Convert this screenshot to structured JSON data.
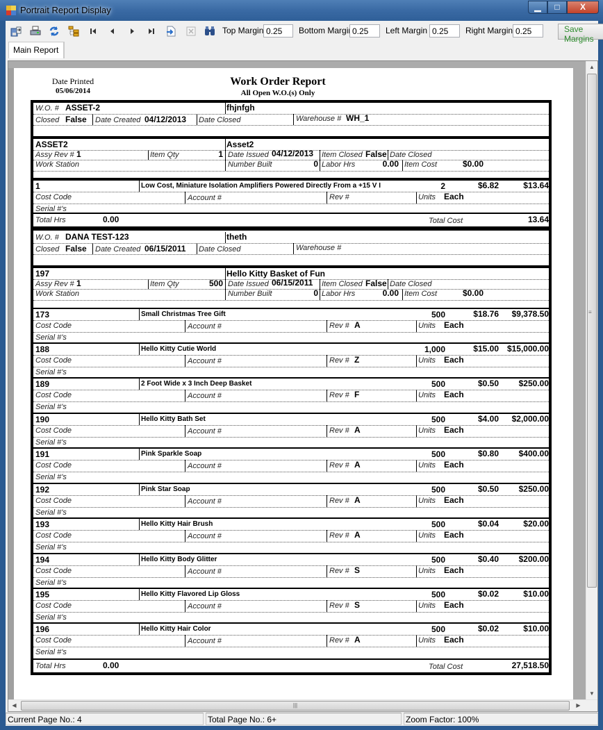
{
  "window": {
    "title": "Portrait Report Display",
    "controls": {
      "minimize": "—",
      "maximize": "□",
      "close": "X"
    }
  },
  "toolbar": {
    "icons": [
      "export-icon",
      "print-icon",
      "refresh-icon",
      "group-tree-icon",
      "first-page-icon",
      "previous-page-icon",
      "next-page-icon",
      "last-page-icon",
      "go-to-page-icon",
      "stop-icon",
      "search-icon"
    ],
    "top_margin_label": "Top Margin",
    "top_margin_value": "0.25",
    "bottom_margin_label": "Bottom Margin",
    "bottom_margin_value": "0.25",
    "left_margin_label": "Left Margin",
    "left_margin_value": "0.25",
    "right_margin_label": "Right Margin",
    "right_margin_value": "0.25",
    "save_label": "Save Margins"
  },
  "tabs": [
    {
      "label": "Main Report",
      "active": true
    }
  ],
  "report": {
    "date_printed_label": "Date Printed",
    "date_printed": "05/06/2014",
    "title": "Work Order Report",
    "subtitle": "All Open W.O.(s) Only",
    "labels": {
      "wo": "W.O. #",
      "closed": "Closed",
      "date_created": "Date Created",
      "date_closed": "Date Closed",
      "warehouse": "Warehouse #",
      "assy_rev": "Assy Rev #",
      "item_qty": "Item Qty",
      "date_issued": "Date Issued",
      "item_closed": "Item Closed",
      "work_station": "Work Station",
      "number_built": "Number Built",
      "labor_hrs": "Labor Hrs",
      "item_cost": "Item Cost",
      "cost_code": "Cost Code",
      "account": "Account #",
      "rev": "Rev #",
      "units": "Units",
      "serials": "Serial #'s",
      "total_hrs": "Total Hrs",
      "total_cost": "Total Cost"
    },
    "work_orders": [
      {
        "wo_number": "ASSET-2",
        "description": "fhjnfgh",
        "closed": "False",
        "date_created": "04/12/2013",
        "date_closed": "",
        "warehouse": "WH_1",
        "assembly": {
          "part": "ASSET2",
          "name": "Asset2",
          "assy_rev": "1",
          "item_qty": "1",
          "date_issued": "04/12/2013",
          "item_closed": "False",
          "date_closed": "",
          "work_station": "",
          "number_built": "0",
          "labor_hrs": "0.00",
          "item_cost": "$0.00"
        },
        "items": [
          {
            "part": "1",
            "description": "Low Cost, Miniature Isolation Amplifiers Powered Directly From a +15 V I",
            "qty": "2",
            "unit_cost": "$6.82",
            "ext_cost": "$13.64",
            "rev": "",
            "units": "Each"
          }
        ],
        "total_hrs": "0.00",
        "total_cost": "13.64"
      },
      {
        "wo_number": "DANA TEST-123",
        "description": "theth",
        "closed": "False",
        "date_created": "06/15/2011",
        "date_closed": "",
        "warehouse": "",
        "assembly": {
          "part": "197",
          "name": "Hello Kitty Basket of Fun",
          "assy_rev": "1",
          "item_qty": "500",
          "date_issued": "06/15/2011",
          "item_closed": "False",
          "date_closed": "",
          "work_station": "",
          "number_built": "0",
          "labor_hrs": "0.00",
          "item_cost": "$0.00"
        },
        "items": [
          {
            "part": "173",
            "description": "Small Christmas Tree Gift",
            "qty": "500",
            "unit_cost": "$18.76",
            "ext_cost": "$9,378.50",
            "rev": "A",
            "units": "Each"
          },
          {
            "part": "188",
            "description": "Hello Kitty Cutie World",
            "qty": "1,000",
            "unit_cost": "$15.00",
            "ext_cost": "$15,000.00",
            "rev": "Z",
            "units": "Each"
          },
          {
            "part": "189",
            "description": "2 Foot Wide x 3 Inch Deep Basket",
            "qty": "500",
            "unit_cost": "$0.50",
            "ext_cost": "$250.00",
            "rev": "F",
            "units": "Each"
          },
          {
            "part": "190",
            "description": "Hello Kitty Bath Set",
            "qty": "500",
            "unit_cost": "$4.00",
            "ext_cost": "$2,000.00",
            "rev": "A",
            "units": "Each"
          },
          {
            "part": "191",
            "description": "Pink Sparkle Soap",
            "qty": "500",
            "unit_cost": "$0.80",
            "ext_cost": "$400.00",
            "rev": "A",
            "units": "Each"
          },
          {
            "part": "192",
            "description": "Pink Star Soap",
            "qty": "500",
            "unit_cost": "$0.50",
            "ext_cost": "$250.00",
            "rev": "A",
            "units": "Each"
          },
          {
            "part": "193",
            "description": "Hello Kitty Hair Brush",
            "qty": "500",
            "unit_cost": "$0.04",
            "ext_cost": "$20.00",
            "rev": "A",
            "units": "Each"
          },
          {
            "part": "194",
            "description": "Hello Kitty Body Glitter",
            "qty": "500",
            "unit_cost": "$0.40",
            "ext_cost": "$200.00",
            "rev": "S",
            "units": "Each"
          },
          {
            "part": "195",
            "description": "Hello Kitty Flavored Lip Gloss",
            "qty": "500",
            "unit_cost": "$0.02",
            "ext_cost": "$10.00",
            "rev": "S",
            "units": "Each"
          },
          {
            "part": "196",
            "description": "Hello Kitty Hair Color",
            "qty": "500",
            "unit_cost": "$0.02",
            "ext_cost": "$10.00",
            "rev": "A",
            "units": "Each"
          }
        ],
        "total_hrs": "0.00",
        "total_cost": "27,518.50"
      }
    ]
  },
  "statusbar": {
    "current_page": "Current Page No.: 4",
    "total_pages": "Total Page No.: 6+",
    "zoom": "Zoom Factor: 100%"
  }
}
